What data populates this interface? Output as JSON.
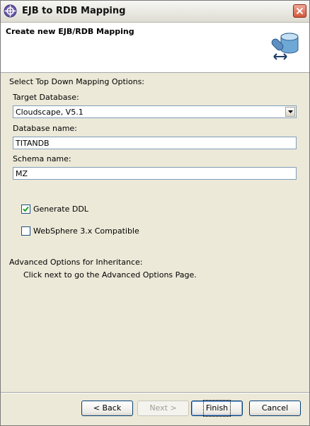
{
  "window": {
    "title": "EJB to RDB Mapping"
  },
  "banner": {
    "title": "Create new EJB/RDB Mapping"
  },
  "options": {
    "section_label": "Select Top Down Mapping Options:",
    "target_db_label": "Target Database:",
    "target_db_value": "Cloudscape, V5.1",
    "db_name_label": "Database name:",
    "db_name_value": "TITANDB",
    "schema_label": "Schema name:",
    "schema_value": "MZ",
    "generate_ddl": {
      "label": "Generate DDL",
      "checked": true
    },
    "ws3_compat": {
      "label": "WebSphere 3.x Compatible",
      "checked": false
    }
  },
  "advanced": {
    "heading": "Advanced Options for Inheritance:",
    "hint": "Click next to go the Advanced Options Page."
  },
  "buttons": {
    "back": "< Back",
    "next": "Next >",
    "finish": "Finish",
    "cancel": "Cancel"
  },
  "colors": {
    "banner_bg": "#ffffff",
    "dialog_bg": "#ece9d8",
    "close_red": "#d4573c"
  }
}
